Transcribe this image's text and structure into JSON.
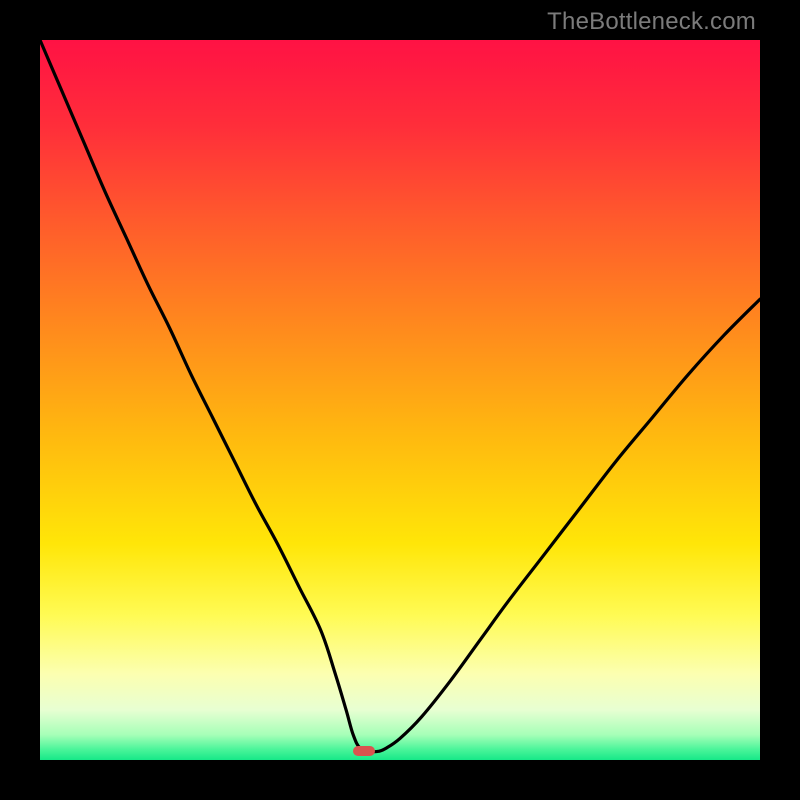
{
  "watermark": "TheBottleneck.com",
  "colors": {
    "curve": "#000000",
    "marker": "#d9534f",
    "frame_bg": "#000000",
    "gradient_stops": [
      {
        "offset": 0.0,
        "color": "#ff1244"
      },
      {
        "offset": 0.12,
        "color": "#ff2e3a"
      },
      {
        "offset": 0.25,
        "color": "#ff5a2c"
      },
      {
        "offset": 0.4,
        "color": "#ff8a1d"
      },
      {
        "offset": 0.55,
        "color": "#ffb90f"
      },
      {
        "offset": 0.7,
        "color": "#ffe608"
      },
      {
        "offset": 0.8,
        "color": "#fffb55"
      },
      {
        "offset": 0.88,
        "color": "#fcffb0"
      },
      {
        "offset": 0.93,
        "color": "#e8ffd2"
      },
      {
        "offset": 0.965,
        "color": "#a6ffb8"
      },
      {
        "offset": 0.985,
        "color": "#4cf59a"
      },
      {
        "offset": 1.0,
        "color": "#17e888"
      }
    ]
  },
  "chart_data": {
    "type": "line",
    "title": "",
    "xlabel": "",
    "ylabel": "",
    "xlim": [
      0,
      100
    ],
    "ylim": [
      0,
      100
    ],
    "grid": false,
    "series": [
      {
        "name": "bottleneck-curve",
        "x": [
          0,
          3,
          6,
          9,
          12,
          15,
          18,
          21,
          24,
          27,
          30,
          33,
          36,
          39,
          41,
          42.5,
          43.5,
          44.5,
          46,
          47,
          48,
          50,
          53,
          57,
          61,
          65,
          70,
          75,
          80,
          85,
          90,
          95,
          100
        ],
        "values": [
          100,
          93,
          86,
          79,
          72.5,
          66,
          60,
          53.5,
          47.5,
          41.5,
          35.5,
          30,
          24,
          18,
          12,
          7,
          3.5,
          1.6,
          1.2,
          1.2,
          1.6,
          3,
          6,
          11,
          16.5,
          22,
          28.5,
          35,
          41.5,
          47.5,
          53.5,
          59,
          64
        ]
      }
    ],
    "marker": {
      "name": "optimal-point",
      "x": 45,
      "y": 1.2
    },
    "annotations": []
  }
}
